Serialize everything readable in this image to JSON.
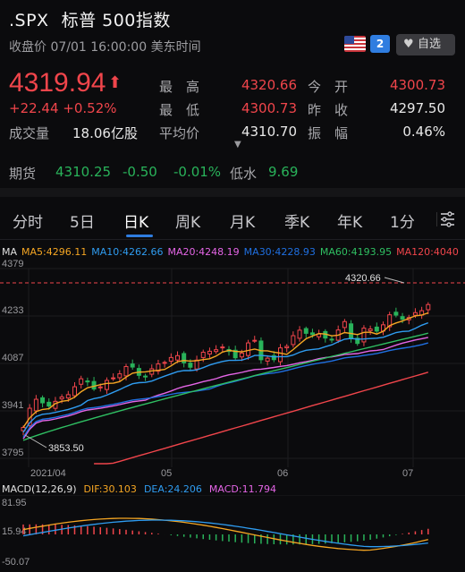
{
  "header": {
    "symbol": ".SPX",
    "name": "标普 500指数",
    "status": "收盘价 07/01 16:00:00 美东时间",
    "lvl_badge": "2",
    "favorite_label": "自选"
  },
  "quote": {
    "price": "4319.94",
    "change": "+22.44",
    "change_pct": "+0.52%",
    "volume_label": "成交量",
    "volume": "18.06亿股",
    "high_label": "最　高",
    "high": "4320.66",
    "low_label": "最　低",
    "low": "4300.73",
    "avg_label": "平均价",
    "avg": "4310.70",
    "open_label": "今　开",
    "open": "4300.73",
    "prev_close_label": "昨　收",
    "prev_close": "4297.50",
    "amplitude_label": "振　幅",
    "amplitude": "0.46%"
  },
  "futures": {
    "label": "期货",
    "price": "4310.25",
    "change": "-0.50",
    "change_pct": "-0.01%",
    "low_water_label": "低水",
    "low_water": "9.69"
  },
  "tabs": [
    "分时",
    "5日",
    "日K",
    "周K",
    "月K",
    "季K",
    "年K",
    "1分"
  ],
  "active_tab": "日K",
  "ma_legend": [
    {
      "text": "MA",
      "color": "#e0e0e0"
    },
    {
      "text": "MA5:4296.11",
      "color": "#f5a623"
    },
    {
      "text": "MA10:4262.66",
      "color": "#2f9cf0"
    },
    {
      "text": "MA20:4248.19",
      "color": "#e465e6"
    },
    {
      "text": "MA30:4228.93",
      "color": "#1f6fe0"
    },
    {
      "text": "MA60:4193.95",
      "color": "#2fbf62"
    },
    {
      "text": "MA120:4040",
      "color": "#f0454b"
    }
  ],
  "macd_legend": [
    {
      "text": "MACD(12,26,9)",
      "color": "#e0e0e0"
    },
    {
      "text": "DIF:30.103",
      "color": "#f5a623"
    },
    {
      "text": "DEA:24.206",
      "color": "#2f9cf0"
    },
    {
      "text": "MACD:11.794",
      "color": "#e465e6"
    }
  ],
  "colors": {
    "up": "#f0454b",
    "down": "#29b35a",
    "ma5": "#f5a623",
    "ma10": "#2f9cf0",
    "ma20": "#e465e6",
    "ma30": "#1f6fe0",
    "ma60": "#2fbf62",
    "ma120": "#f0454b"
  },
  "chart_data": {
    "type": "candlestick",
    "y_ticks": [
      "4379",
      "4233",
      "4087",
      "3941",
      "3795"
    ],
    "ylim": [
      3795,
      4379
    ],
    "x_ticks": [
      "2021/04",
      "05",
      "06",
      "07"
    ],
    "max_annotation": "4320.66",
    "min_annotation": "3853.50",
    "macd_y_ticks": [
      "81.95",
      "15.94",
      "-50.07"
    ],
    "macd_ylim": [
      -50.07,
      81.95
    ]
  }
}
